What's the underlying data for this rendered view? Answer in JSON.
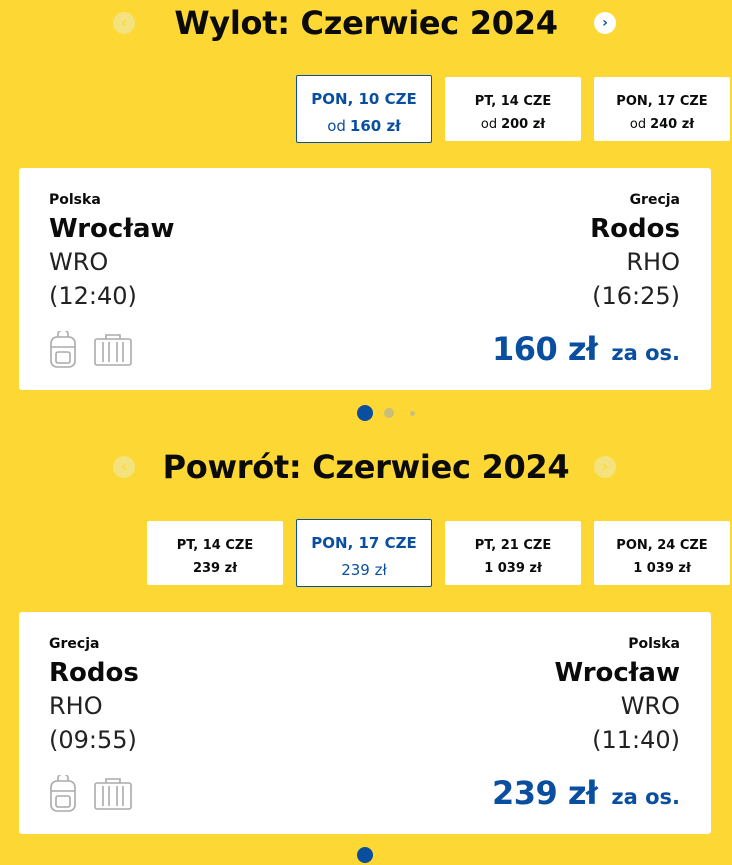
{
  "outbound": {
    "title": "Wylot: Czerwiec 2024",
    "dates": [
      {
        "day": "PON, 10 CZE",
        "prefix": "od",
        "price": "160 zł",
        "selected": true
      },
      {
        "day": "PT, 14 CZE",
        "prefix": "od",
        "price": "200 zł",
        "selected": false
      },
      {
        "day": "PON, 17 CZE",
        "prefix": "od",
        "price": "240 zł",
        "selected": false
      }
    ],
    "flight": {
      "from_country": "Polska",
      "from_city": "Wrocław",
      "from_code": "WRO",
      "from_time": "(12:40)",
      "to_country": "Grecja",
      "to_city": "Rodos",
      "to_code": "RHO",
      "to_time": "(16:25)",
      "price": "160 zł",
      "per_person": "za os."
    }
  },
  "inbound": {
    "title": "Powrót: Czerwiec 2024",
    "dates": [
      {
        "day": "PT, 14 CZE",
        "price": "239 zł",
        "selected": false
      },
      {
        "day": "PON, 17 CZE",
        "price": "239 zł",
        "selected": true
      },
      {
        "day": "PT, 21 CZE",
        "price": "1 039 zł",
        "selected": false
      },
      {
        "day": "PON, 24 CZE",
        "price": "1 039 zł",
        "selected": false
      }
    ],
    "flight": {
      "from_country": "Grecja",
      "from_city": "Rodos",
      "from_code": "RHO",
      "from_time": "(09:55)",
      "to_country": "Polska",
      "to_city": "Wrocław",
      "to_code": "WRO",
      "to_time": "(11:40)",
      "price": "239 zł",
      "per_person": "za os."
    }
  },
  "icons": {
    "prev": "chevron-left-icon",
    "next": "chevron-right-icon",
    "backpack": "backpack-icon",
    "suitcase": "suitcase-icon"
  },
  "colors": {
    "background": "#fdd835",
    "accent": "#0a4f9f",
    "card": "#ffffff"
  }
}
